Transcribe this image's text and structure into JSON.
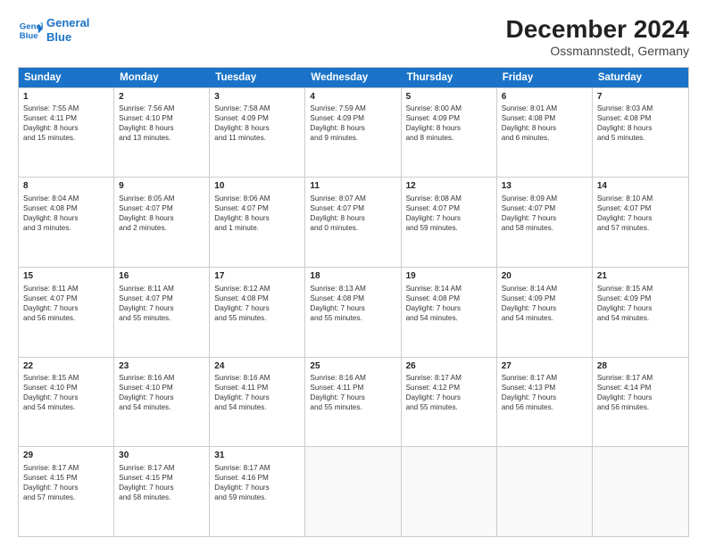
{
  "header": {
    "logo_general": "General",
    "logo_blue": "Blue",
    "month_title": "December 2024",
    "subtitle": "Ossmannstedt, Germany"
  },
  "weekdays": [
    "Sunday",
    "Monday",
    "Tuesday",
    "Wednesday",
    "Thursday",
    "Friday",
    "Saturday"
  ],
  "rows": [
    [
      {
        "day": "1",
        "lines": [
          "Sunrise: 7:55 AM",
          "Sunset: 4:11 PM",
          "Daylight: 8 hours",
          "and 15 minutes."
        ]
      },
      {
        "day": "2",
        "lines": [
          "Sunrise: 7:56 AM",
          "Sunset: 4:10 PM",
          "Daylight: 8 hours",
          "and 13 minutes."
        ]
      },
      {
        "day": "3",
        "lines": [
          "Sunrise: 7:58 AM",
          "Sunset: 4:09 PM",
          "Daylight: 8 hours",
          "and 11 minutes."
        ]
      },
      {
        "day": "4",
        "lines": [
          "Sunrise: 7:59 AM",
          "Sunset: 4:09 PM",
          "Daylight: 8 hours",
          "and 9 minutes."
        ]
      },
      {
        "day": "5",
        "lines": [
          "Sunrise: 8:00 AM",
          "Sunset: 4:09 PM",
          "Daylight: 8 hours",
          "and 8 minutes."
        ]
      },
      {
        "day": "6",
        "lines": [
          "Sunrise: 8:01 AM",
          "Sunset: 4:08 PM",
          "Daylight: 8 hours",
          "and 6 minutes."
        ]
      },
      {
        "day": "7",
        "lines": [
          "Sunrise: 8:03 AM",
          "Sunset: 4:08 PM",
          "Daylight: 8 hours",
          "and 5 minutes."
        ]
      }
    ],
    [
      {
        "day": "8",
        "lines": [
          "Sunrise: 8:04 AM",
          "Sunset: 4:08 PM",
          "Daylight: 8 hours",
          "and 3 minutes."
        ]
      },
      {
        "day": "9",
        "lines": [
          "Sunrise: 8:05 AM",
          "Sunset: 4:07 PM",
          "Daylight: 8 hours",
          "and 2 minutes."
        ]
      },
      {
        "day": "10",
        "lines": [
          "Sunrise: 8:06 AM",
          "Sunset: 4:07 PM",
          "Daylight: 8 hours",
          "and 1 minute."
        ]
      },
      {
        "day": "11",
        "lines": [
          "Sunrise: 8:07 AM",
          "Sunset: 4:07 PM",
          "Daylight: 8 hours",
          "and 0 minutes."
        ]
      },
      {
        "day": "12",
        "lines": [
          "Sunrise: 8:08 AM",
          "Sunset: 4:07 PM",
          "Daylight: 7 hours",
          "and 59 minutes."
        ]
      },
      {
        "day": "13",
        "lines": [
          "Sunrise: 8:09 AM",
          "Sunset: 4:07 PM",
          "Daylight: 7 hours",
          "and 58 minutes."
        ]
      },
      {
        "day": "14",
        "lines": [
          "Sunrise: 8:10 AM",
          "Sunset: 4:07 PM",
          "Daylight: 7 hours",
          "and 57 minutes."
        ]
      }
    ],
    [
      {
        "day": "15",
        "lines": [
          "Sunrise: 8:11 AM",
          "Sunset: 4:07 PM",
          "Daylight: 7 hours",
          "and 56 minutes."
        ]
      },
      {
        "day": "16",
        "lines": [
          "Sunrise: 8:11 AM",
          "Sunset: 4:07 PM",
          "Daylight: 7 hours",
          "and 55 minutes."
        ]
      },
      {
        "day": "17",
        "lines": [
          "Sunrise: 8:12 AM",
          "Sunset: 4:08 PM",
          "Daylight: 7 hours",
          "and 55 minutes."
        ]
      },
      {
        "day": "18",
        "lines": [
          "Sunrise: 8:13 AM",
          "Sunset: 4:08 PM",
          "Daylight: 7 hours",
          "and 55 minutes."
        ]
      },
      {
        "day": "19",
        "lines": [
          "Sunrise: 8:14 AM",
          "Sunset: 4:08 PM",
          "Daylight: 7 hours",
          "and 54 minutes."
        ]
      },
      {
        "day": "20",
        "lines": [
          "Sunrise: 8:14 AM",
          "Sunset: 4:09 PM",
          "Daylight: 7 hours",
          "and 54 minutes."
        ]
      },
      {
        "day": "21",
        "lines": [
          "Sunrise: 8:15 AM",
          "Sunset: 4:09 PM",
          "Daylight: 7 hours",
          "and 54 minutes."
        ]
      }
    ],
    [
      {
        "day": "22",
        "lines": [
          "Sunrise: 8:15 AM",
          "Sunset: 4:10 PM",
          "Daylight: 7 hours",
          "and 54 minutes."
        ]
      },
      {
        "day": "23",
        "lines": [
          "Sunrise: 8:16 AM",
          "Sunset: 4:10 PM",
          "Daylight: 7 hours",
          "and 54 minutes."
        ]
      },
      {
        "day": "24",
        "lines": [
          "Sunrise: 8:16 AM",
          "Sunset: 4:11 PM",
          "Daylight: 7 hours",
          "and 54 minutes."
        ]
      },
      {
        "day": "25",
        "lines": [
          "Sunrise: 8:16 AM",
          "Sunset: 4:11 PM",
          "Daylight: 7 hours",
          "and 55 minutes."
        ]
      },
      {
        "day": "26",
        "lines": [
          "Sunrise: 8:17 AM",
          "Sunset: 4:12 PM",
          "Daylight: 7 hours",
          "and 55 minutes."
        ]
      },
      {
        "day": "27",
        "lines": [
          "Sunrise: 8:17 AM",
          "Sunset: 4:13 PM",
          "Daylight: 7 hours",
          "and 56 minutes."
        ]
      },
      {
        "day": "28",
        "lines": [
          "Sunrise: 8:17 AM",
          "Sunset: 4:14 PM",
          "Daylight: 7 hours",
          "and 56 minutes."
        ]
      }
    ],
    [
      {
        "day": "29",
        "lines": [
          "Sunrise: 8:17 AM",
          "Sunset: 4:15 PM",
          "Daylight: 7 hours",
          "and 57 minutes."
        ]
      },
      {
        "day": "30",
        "lines": [
          "Sunrise: 8:17 AM",
          "Sunset: 4:15 PM",
          "Daylight: 7 hours",
          "and 58 minutes."
        ]
      },
      {
        "day": "31",
        "lines": [
          "Sunrise: 8:17 AM",
          "Sunset: 4:16 PM",
          "Daylight: 7 hours",
          "and 59 minutes."
        ]
      },
      null,
      null,
      null,
      null
    ]
  ]
}
